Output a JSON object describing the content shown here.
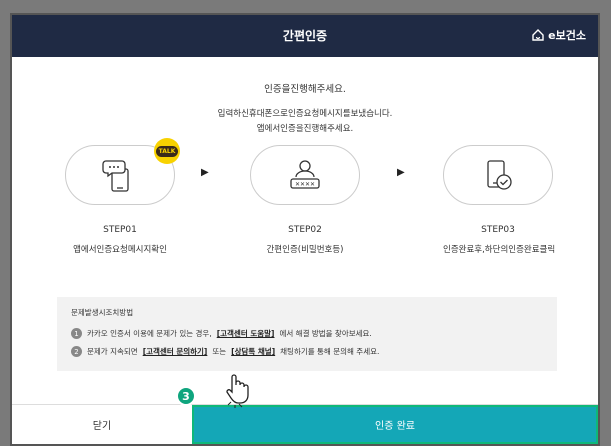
{
  "header": {
    "title": "간편인증",
    "brand": "e보건소"
  },
  "intro": {
    "line1": "인증을진행해주세요.",
    "line2": "입력하신휴대폰으로인증요청메시지를보냈습니다.",
    "line3": "앱에서인증을진행해주세요."
  },
  "steps": [
    {
      "num": "STEP01",
      "desc": "앱에서인증요청메시지확인",
      "badge": "TALK"
    },
    {
      "num": "STEP02",
      "desc": "간편인증(비밀번호등)"
    },
    {
      "num": "STEP03",
      "desc": "인증완료후,하단의인증완료클릭"
    }
  ],
  "notice": {
    "heading": "문제발생시조치방법",
    "items": [
      {
        "n": "1",
        "pre": "카카오 인증서 이용에 문제가 있는 경우,",
        "link": "[고객센터 도움말]",
        "post": "에서 해결 방법을 찾아보세요."
      },
      {
        "n": "2",
        "pre": "문제가 지속되면",
        "link": "[고객센터 문의하기]",
        "mid": "또는",
        "link2": "[상담톡 채널]",
        "post": "채팅하기를 통해 문의해 주세요."
      }
    ]
  },
  "footer": {
    "close_label": "닫기",
    "done_label": "인증 완료"
  },
  "annotation": {
    "step_badge": "3"
  },
  "colors": {
    "header_bg": "#1f2a44",
    "done_bg": "#14a7b7",
    "badge_green": "#0fa57e",
    "talk_yellow": "#f8d200"
  }
}
